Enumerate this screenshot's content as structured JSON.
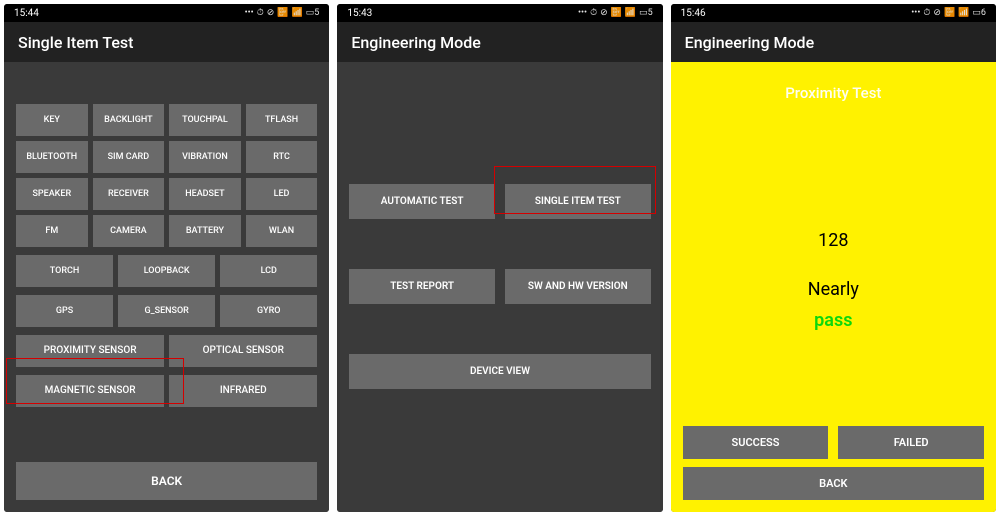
{
  "screens": [
    {
      "time": "15:44",
      "title": "Single Item Test",
      "grid": [
        "KEY",
        "BACKLIGHT",
        "TOUCHPAL",
        "TFLASH",
        "BLUETOOTH",
        "SIM CARD",
        "VIBRATION",
        "RTC",
        "SPEAKER",
        "RECEIVER",
        "HEADSET",
        "LED",
        "FM",
        "CAMERA",
        "BATTERY",
        "WLAN"
      ],
      "row3a": [
        "TORCH",
        "LOOPBACK",
        "LCD"
      ],
      "row3b": [
        "GPS",
        "G_SENSOR",
        "GYRO"
      ],
      "wide": [
        "PROXIMITY SENSOR",
        "OPTICAL SENSOR",
        "MAGNETIC SENSOR",
        "INFRARED"
      ],
      "back": "BACK"
    },
    {
      "time": "15:43",
      "title": "Engineering Mode",
      "row1": [
        "AUTOMATIC TEST",
        "SINGLE ITEM TEST"
      ],
      "row2": [
        "TEST REPORT",
        "SW AND HW VERSION"
      ],
      "row3": [
        "DEVICE VIEW"
      ]
    },
    {
      "time": "15:46",
      "title": "Engineering Mode",
      "prox_title": "Proximity Test",
      "value": "128",
      "status1": "Nearly",
      "status2": "pass",
      "success": "SUCCESS",
      "failed": "FAILED",
      "back": "BACK"
    }
  ],
  "battery": "5",
  "battery3": "6"
}
